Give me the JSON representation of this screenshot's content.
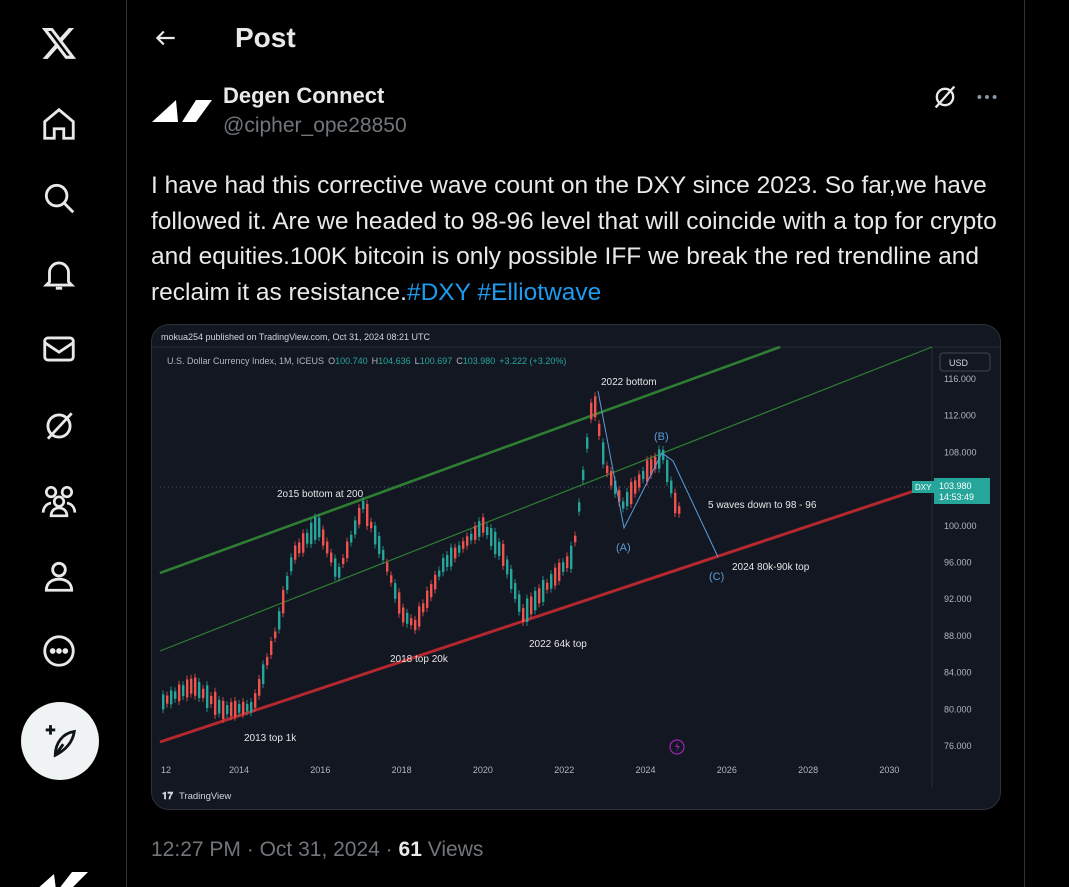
{
  "nav": {
    "items": [
      "x-logo",
      "home",
      "explore",
      "notifications",
      "messages",
      "grok",
      "communities",
      "profile",
      "more"
    ]
  },
  "header": {
    "title": "Post"
  },
  "author": {
    "name": "Degen Connect",
    "handle": "@cipher_ope28850"
  },
  "tweet": {
    "text": "I have had this corrective wave count on the DXY since 2023. So far,we have followed it. Are we headed to 98-96 level that will coincide with a top for crypto and equities.100K bitcoin is only possible IFF we break the red trendline and reclaim it as resistance.",
    "hashtags": [
      "#DXY",
      "#Elliotwave"
    ]
  },
  "chart_image": {
    "publisher_line": "mokua254 published on TradingView.com, Oct 31, 2024 08:21 UTC",
    "symbol_line": "U.S. Dollar Currency Index, 1M, ICEUS",
    "ohlc": {
      "o_label": "O",
      "o": "100.740",
      "h_label": "H",
      "h": "104.636",
      "l_label": "L",
      "l": "100.697",
      "c_label": "C",
      "c": "103.980",
      "change": "+3.222 (+3.20%)"
    },
    "currency": "USD",
    "price_tag": {
      "symbol": "DXY",
      "price": "103.980",
      "countdown": "14:53:49"
    },
    "y_ticks": [
      "116.000",
      "112.000",
      "108.000",
      "104.000",
      "100.000",
      "96.000",
      "92.000",
      "88.000",
      "84.000",
      "80.000",
      "76.000"
    ],
    "x_ticks": [
      "12",
      "2014",
      "2016",
      "2018",
      "2020",
      "2022",
      "2024",
      "2026",
      "2028",
      "2030"
    ],
    "annotations": {
      "a1": "2022 bottom",
      "a2": "2o15  bottom at 200",
      "a3": "5 waves down to 98 - 96",
      "a4": "2024  80k-90k top",
      "a5": "2018  top  20k",
      "a6": "2022  64k  top",
      "a7": "2013  top  1k",
      "wave_a": "(A)",
      "wave_b": "(B)",
      "wave_c": "(C)"
    },
    "brand": "TradingView",
    "colors": {
      "up": "#26a69a",
      "down": "#ef5350",
      "upper_channel": "#2e7d32",
      "lower_trend": "#b2282e",
      "wave_line": "#5b9bd5"
    }
  },
  "meta": {
    "time": "12:27 PM",
    "sep": "·",
    "date": "Oct 31, 2024",
    "sep2": "·",
    "views": "61",
    "views_label": "Views"
  }
}
